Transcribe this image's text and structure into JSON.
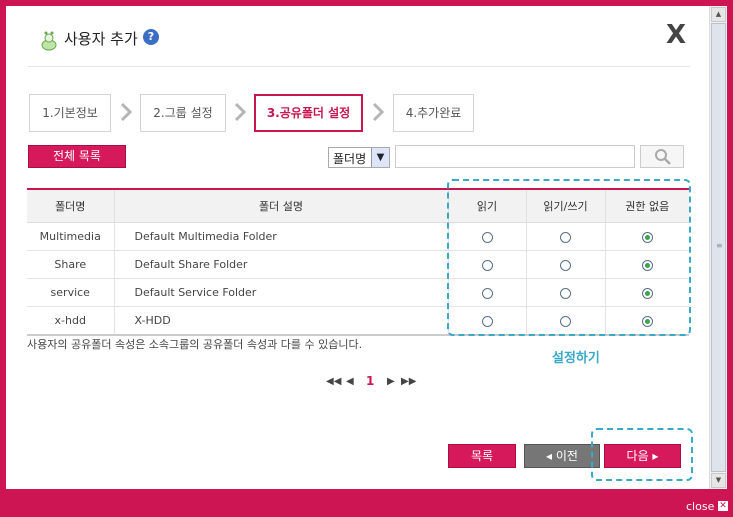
{
  "dialog": {
    "title": "사용자 추가",
    "help_glyph": "?",
    "close_glyph": "X"
  },
  "steps": [
    {
      "label": "1.기본정보",
      "active": false
    },
    {
      "label": "2.그룹 설정",
      "active": false
    },
    {
      "label": "3.공유폴더 설정",
      "active": true
    },
    {
      "label": "4.추가완료",
      "active": false
    }
  ],
  "toolbar": {
    "list_all_label": "전체 목록",
    "filter_selected": "폴더명",
    "search_value": ""
  },
  "table": {
    "headers": [
      "폴더명",
      "폴더 설명",
      "읽기",
      "읽기/쓰기",
      "권한 없음"
    ],
    "rows": [
      {
        "name": "Multimedia",
        "desc": "Default Multimedia Folder",
        "permission": "none"
      },
      {
        "name": "Share",
        "desc": "Default Share Folder",
        "permission": "none"
      },
      {
        "name": "service",
        "desc": "Default Service Folder",
        "permission": "none"
      },
      {
        "name": "x-hdd",
        "desc": "X-HDD",
        "permission": "none"
      }
    ]
  },
  "note": "사용자의 공유폴더 속성은 소속그룹의 공유폴더 속성과 다를 수 있습니다.",
  "annotation": {
    "setting_label": "설정하기"
  },
  "pagination": {
    "current_page": "1"
  },
  "buttons": {
    "list_label": "목록",
    "prev_label": "◂ 이전",
    "next_label": "다음 ▸"
  },
  "footer": {
    "close_label": "close",
    "close_glyph": "✕"
  },
  "colors": {
    "brand": "#cc1552",
    "annotation": "#38a9c9",
    "radio_on": "#3aa64a"
  },
  "icons": {
    "title_icon": "user-add-icon",
    "search_icon": "magnifier-icon"
  }
}
